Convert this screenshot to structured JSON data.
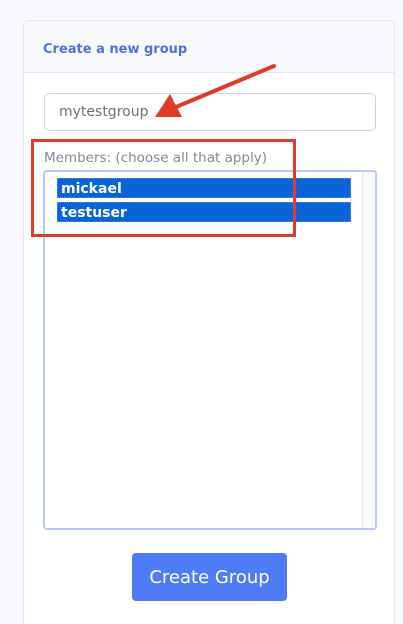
{
  "card": {
    "title": "Create a new group"
  },
  "group_name_input": {
    "value": "mytestgroup"
  },
  "members": {
    "label": "Members: (choose all that apply)",
    "options": [
      {
        "label": "mickael",
        "selected": true
      },
      {
        "label": "testuser",
        "selected": true
      }
    ]
  },
  "create_button": {
    "label": "Create Group"
  },
  "colors": {
    "accent": "#4e73df",
    "button": "#4e7cf6",
    "selection": "#0a64d8",
    "annotation": "#e03a2b"
  }
}
